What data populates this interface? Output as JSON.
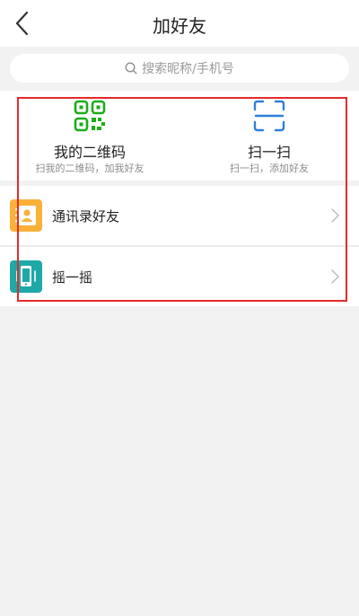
{
  "header": {
    "title": "加好友",
    "back_icon": "chevron-left-icon"
  },
  "search": {
    "placeholder": "搜索昵称/手机号",
    "icon": "search-icon"
  },
  "actions": [
    {
      "title": "我的二维码",
      "subtitle": "扫我的二维码，加我好友",
      "icon": "qr-code-icon",
      "color": "#1aad19"
    },
    {
      "title": "扫一扫",
      "subtitle": "扫一扫，添加好友",
      "icon": "scan-icon",
      "color": "#2f7fd8"
    }
  ],
  "list": [
    {
      "label": "通讯录好友",
      "icon": "contacts-icon",
      "color": "#f9b13a"
    },
    {
      "label": "摇一摇",
      "icon": "shake-phone-icon",
      "color": "#1fa8a8"
    }
  ],
  "colors": {
    "highlight": "#e52a2a",
    "background": "#f2f2f2"
  }
}
